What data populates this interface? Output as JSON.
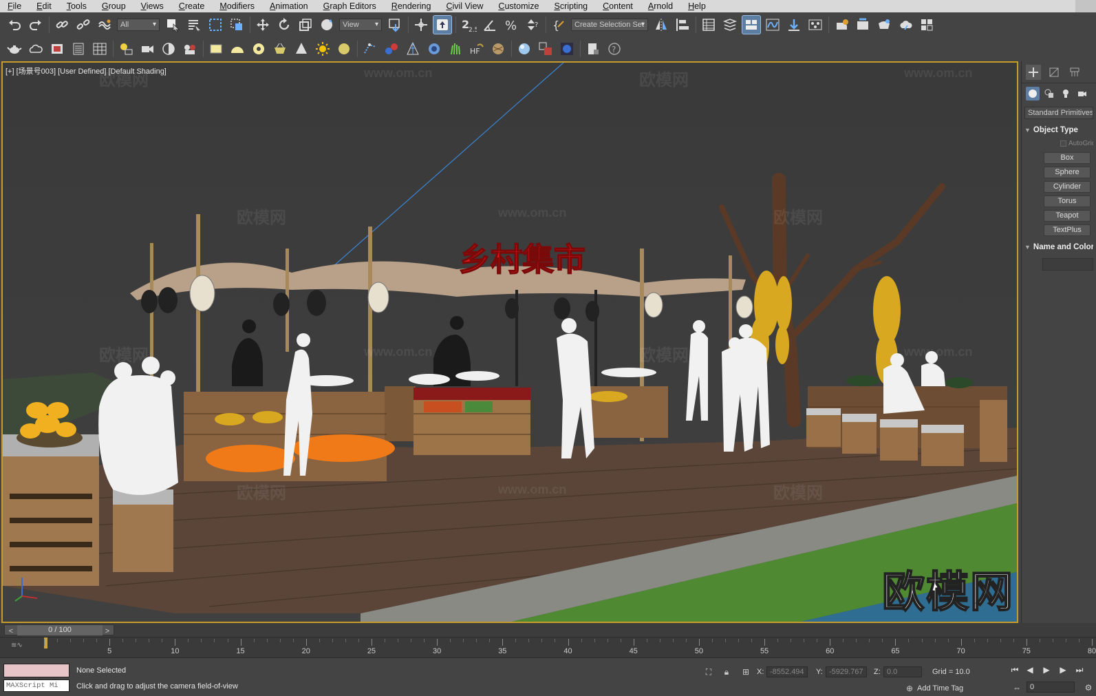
{
  "menu": {
    "items": [
      "File",
      "Edit",
      "Tools",
      "Group",
      "Views",
      "Create",
      "Modifiers",
      "Animation",
      "Graph Editors",
      "Rendering",
      "Civil View",
      "Customize",
      "Scripting",
      "Content",
      "Arnold",
      "Help"
    ]
  },
  "toolbar": {
    "selection_filter": "All",
    "ref_coord": "View",
    "snap_value": "2.5",
    "named_selection": "Create Selection Set"
  },
  "viewport": {
    "label": "[+] [场景号003] [User Defined] [Default Shading]",
    "sign_text": "乡村集市",
    "watermark_text": "欧模网",
    "watermark_url": "www.om.cn",
    "big_watermark": "欧模网"
  },
  "command_panel": {
    "category": "Standard Primitives",
    "object_type_title": "Object Type",
    "autogrid_label": "AutoGrid",
    "buttons": [
      "Box",
      "Sphere",
      "Cylinder",
      "Torus",
      "Teapot",
      "TextPlus"
    ],
    "name_color_title": "Name and Color"
  },
  "time_slider": {
    "label": "0 / 100",
    "prev": "<",
    "next": ">"
  },
  "trackbar": {
    "ticks": [
      0,
      5,
      10,
      15,
      20,
      25,
      30,
      35,
      40,
      45,
      50,
      55,
      60,
      65,
      70,
      75,
      80
    ],
    "tick_labels": [
      "5",
      "10",
      "15",
      "20",
      "25",
      "30",
      "35",
      "40",
      "45",
      "50",
      "55",
      "60",
      "65",
      "70",
      "75",
      "80"
    ]
  },
  "status": {
    "maxscript": "MAXScript Mi",
    "selection": "None Selected",
    "prompt": "Click and drag to adjust the camera field-of-view",
    "x_label": "X:",
    "x_value": "-8552.494",
    "y_label": "Y:",
    "y_value": "-5929.767",
    "z_label": "Z:",
    "z_value": "0.0",
    "grid": "Grid = 10.0",
    "add_time_tag": "Add Time Tag",
    "frame": "0"
  },
  "colors": {
    "viewport_border": "#c89c2a",
    "active_blue": "#5d7da3",
    "sign_red": "#e01818"
  }
}
